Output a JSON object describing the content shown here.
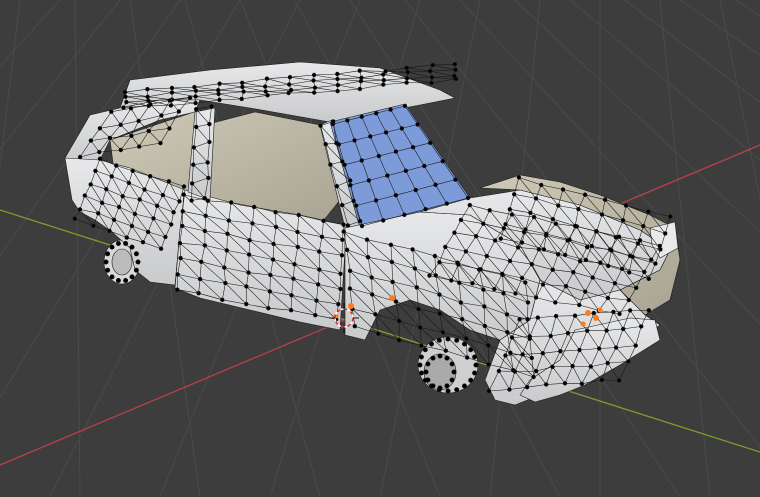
{
  "viewport": {
    "mode": "edit-mode",
    "view": "perspective",
    "background_color": "#3d3d3d",
    "grid_color": "#4a4a4a",
    "axis_x_color": "#b8404a",
    "axis_y_color": "#7aa02a",
    "selection_color": "#7fa0e0",
    "mesh_face_color": "#d7d8da",
    "vertex_color": "#000000",
    "selected_vertex_color": "#ff7a18"
  },
  "object": {
    "type": "car-mesh",
    "selected_face": "windshield"
  }
}
